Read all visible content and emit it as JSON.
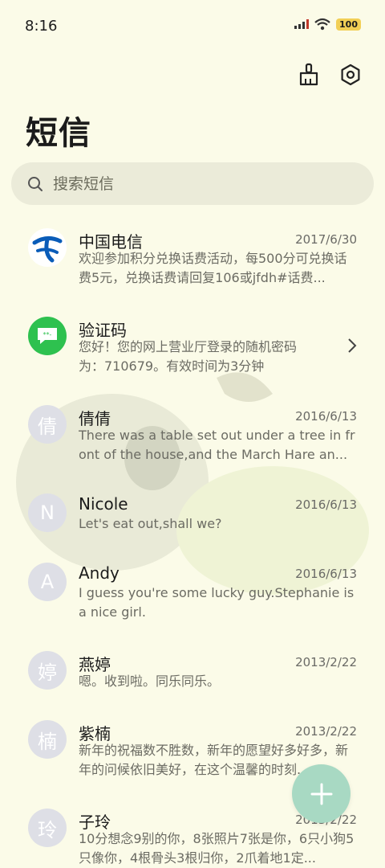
{
  "status": {
    "time": "8:16",
    "battery": "100"
  },
  "header": {
    "title": "短信"
  },
  "search": {
    "placeholder": "搜索短信"
  },
  "conversations": [
    {
      "name": "中国电信",
      "date": "2017/6/30",
      "preview": "欢迎参加积分兑换话费活动，每500分可兑换话费5元，兑换话费请回复106或jfdh#话费..."
    },
    {
      "name": "验证码",
      "date": "",
      "preview": "您好！您的网上营业厅登录的随机密码为：710679。有效时间为3分钟"
    },
    {
      "name": "倩倩",
      "avatar": "倩",
      "date": "2016/6/13",
      "preview": "There was a table set out under a tree in front of the house,and the March Hare an..."
    },
    {
      "name": "Nicole",
      "avatar": "N",
      "date": "2016/6/13",
      "preview": "Let's eat out,shall we?"
    },
    {
      "name": "Andy",
      "avatar": "A",
      "date": "2016/6/13",
      "preview": "I guess you're some lucky guy.Stephanie is a nice girl."
    },
    {
      "name": "燕婷",
      "avatar": "婷",
      "date": "2013/2/22",
      "preview": "嗯。收到啦。同乐同乐。"
    },
    {
      "name": "紫楠",
      "avatar": "楠",
      "date": "2013/2/22",
      "preview": "新年的祝福数不胜数，新年的愿望好多好多，新年的问候依旧美好，在这个温馨的时刻..."
    },
    {
      "name": "子玲",
      "avatar": "玲",
      "date": "2013/2/22",
      "preview": "10分想念9别的你，8张照片7张是你，6只小狗5只像你，4根骨头3根归你，2爪着地1定..."
    }
  ]
}
